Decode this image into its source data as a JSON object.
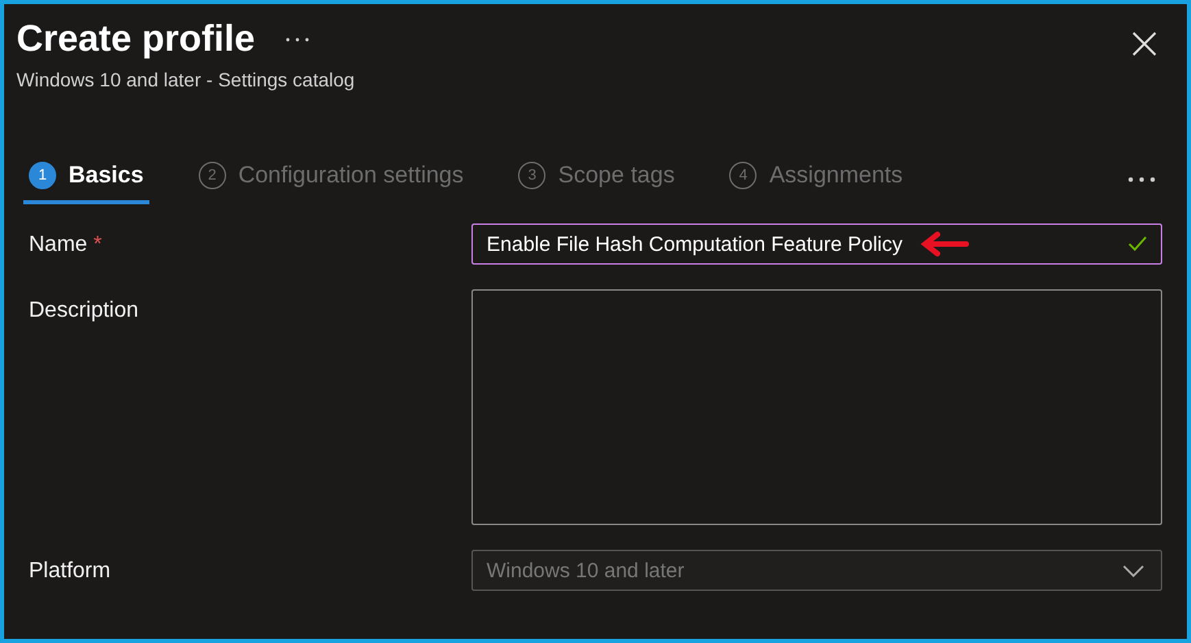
{
  "window": {
    "title": "Create profile",
    "subtitle": "Windows 10 and later - Settings catalog"
  },
  "tabs": [
    {
      "number": "1",
      "label": "Basics",
      "selected": true
    },
    {
      "number": "2",
      "label": "Configuration settings",
      "selected": false
    },
    {
      "number": "3",
      "label": "Scope tags",
      "selected": false
    },
    {
      "number": "4",
      "label": "Assignments",
      "selected": false
    }
  ],
  "form": [
    {
      "kind": "text",
      "label": "Name",
      "required_mark": "*",
      "value": "Enable File Hash Computation Feature Policy",
      "valid": true,
      "annotated": true
    },
    {
      "kind": "textarea",
      "label": "Description"
    },
    {
      "kind": "select",
      "label": "Platform",
      "value": "Windows 10 and later",
      "disabled": true
    }
  ]
}
